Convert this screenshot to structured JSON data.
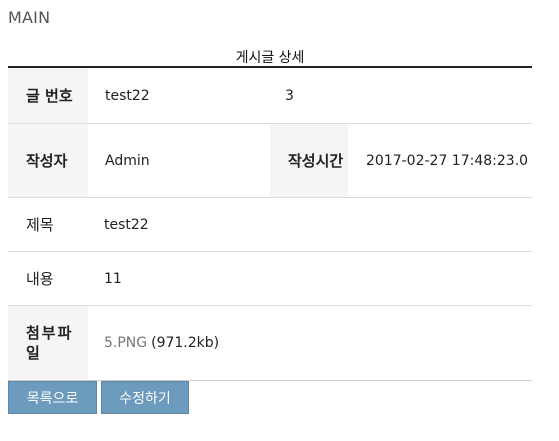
{
  "header": {
    "title": "MAIN"
  },
  "caption": "게시글 상세",
  "rows": {
    "number": {
      "label": "글 번호",
      "value": "test22",
      "extra": "3"
    },
    "author": {
      "label": "작성자",
      "value": "Admin",
      "time_label": "작성시간",
      "time_value": "2017-02-27 17:48:23.0"
    },
    "title": {
      "label": "제목",
      "value": "test22"
    },
    "content": {
      "label": "내용",
      "value": "11"
    },
    "attachment": {
      "label": "첨부파일",
      "file_name": "5.PNG",
      "file_size": "(971.2kb)"
    }
  },
  "buttons": {
    "list": "목록으로",
    "edit": "수정하기"
  },
  "colors": {
    "button_bg": "#6c9bbd",
    "header_bg": "#f5f5f5",
    "top_border": "#222222"
  }
}
